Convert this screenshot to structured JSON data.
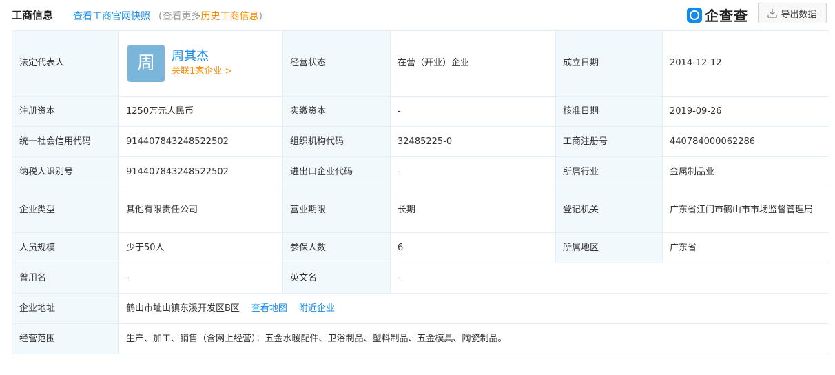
{
  "header": {
    "title": "工商信息",
    "snapshot_link": "查看工商官网快照",
    "hint_prefix": "(查看更多",
    "hint_link": "历史工商信息",
    "hint_suffix": ")",
    "logo_text": "企查查",
    "export_label": "导出数据"
  },
  "colors": {
    "accent": "#128bed",
    "highlight": "#ff8b00",
    "label_bg": "#f2f9fc",
    "avatar_bg": "#7ab6db"
  },
  "legal_rep": {
    "label": "法定代表人",
    "avatar_char": "周",
    "name": "周其杰",
    "related": "关联1家企业 >"
  },
  "fields": {
    "status_label": "经营状态",
    "status": "在营（开业）企业",
    "founded_label": "成立日期",
    "founded": "2014-12-12",
    "reg_capital_label": "注册资本",
    "reg_capital": "1250万元人民币",
    "paid_capital_label": "实缴资本",
    "paid_capital": "-",
    "approved_label": "核准日期",
    "approved": "2019-09-26",
    "credit_code_label": "统一社会信用代码",
    "credit_code": "914407843248522502",
    "org_code_label": "组织机构代码",
    "org_code": "32485225-0",
    "reg_no_label": "工商注册号",
    "reg_no": "440784000062286",
    "taxpayer_label": "纳税人识别号",
    "taxpayer": "914407843248522502",
    "import_export_label": "进出口企业代码",
    "import_export": "-",
    "industry_label": "所属行业",
    "industry": "金属制品业",
    "company_type_label": "企业类型",
    "company_type": "其他有限责任公司",
    "term_label": "营业期限",
    "term": "长期",
    "authority_label": "登记机关",
    "authority": "广东省江门市鹤山市市场监督管理局",
    "staff_label": "人员规模",
    "staff": "少于50人",
    "insured_label": "参保人数",
    "insured": "6",
    "region_label": "所属地区",
    "region": "广东省",
    "former_name_label": "曾用名",
    "former_name": "-",
    "english_name_label": "英文名",
    "english_name": "-",
    "address_label": "企业地址",
    "address": "鹤山市址山镇东溪开发区B区",
    "view_map": "查看地图",
    "nearby": "附近企业",
    "scope_label": "经营范围",
    "scope": "生产、加工、销售（含网上经营）：五金水暖配件、卫浴制品、塑料制品、五金模具、陶瓷制品。"
  }
}
